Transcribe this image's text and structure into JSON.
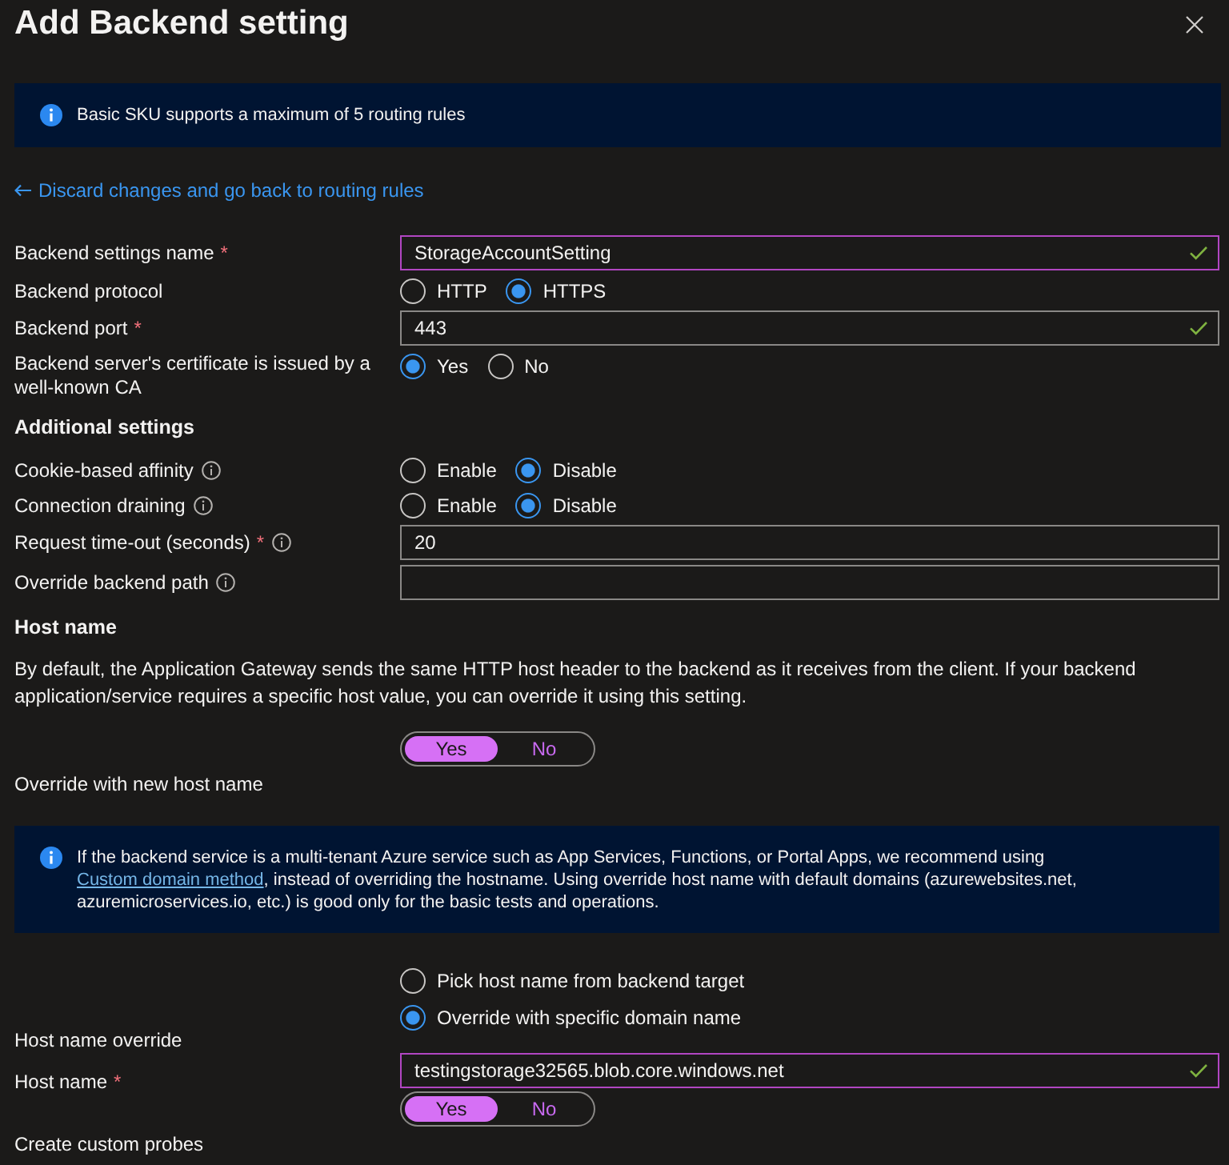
{
  "title": "Add Backend setting",
  "notice": {
    "text": "Basic SKU supports a maximum of 5 routing rules"
  },
  "back_link": {
    "text": "Discard changes and go back to routing rules"
  },
  "rows": [
    {
      "kind": "text",
      "label": "Backend settings name",
      "required_mark": "*",
      "info": false,
      "value": "StorageAccountSetting",
      "modified": true,
      "valid": true
    },
    {
      "kind": "radio",
      "label": "Backend protocol",
      "info": false,
      "options": [
        {
          "label": "HTTP",
          "selected": false
        },
        {
          "label": "HTTPS",
          "selected": true
        }
      ]
    },
    {
      "kind": "text",
      "label": "Backend port",
      "required_mark": "*",
      "info": false,
      "value": "443",
      "modified": false,
      "valid": true
    },
    {
      "kind": "radio",
      "label": "Backend server's certificate is issued by a well-known CA",
      "info": false,
      "options": [
        {
          "label": "Yes",
          "selected": true
        },
        {
          "label": "No",
          "selected": false
        }
      ]
    },
    {
      "kind": "heading",
      "text": "Additional settings"
    },
    {
      "kind": "radio",
      "label": "Cookie-based affinity",
      "info": true,
      "options": [
        {
          "label": "Enable",
          "selected": false
        },
        {
          "label": "Disable",
          "selected": true
        }
      ]
    },
    {
      "kind": "radio",
      "label": "Connection draining",
      "info": true,
      "options": [
        {
          "label": "Enable",
          "selected": false
        },
        {
          "label": "Disable",
          "selected": true
        }
      ]
    },
    {
      "kind": "text",
      "label": "Request time-out (seconds)",
      "required_mark": "*",
      "info": true,
      "value": "20",
      "modified": false,
      "valid": false
    },
    {
      "kind": "text",
      "label": "Override backend path",
      "info": true,
      "modified": false,
      "valid": false
    },
    {
      "kind": "heading",
      "text": "Host name"
    },
    {
      "kind": "paragraph",
      "text": "By default, the Application Gateway sends the same HTTP host header to the backend as it receives from the client. If your backend application/service requires a specific host value, you can override it using this setting."
    },
    {
      "kind": "toggle",
      "label": "Override with new host name",
      "options": [
        {
          "label": "Yes",
          "selected": true
        },
        {
          "label": "No",
          "selected": false
        }
      ]
    },
    {
      "kind": "notice",
      "text_before": "If the backend service is a multi-tenant Azure service such as App Services, Functions, or Portal Apps, we recommend using ",
      "link": "Custom domain method",
      "text_after": ", instead of overriding the hostname. Using override host name with default domains (azurewebsites.net, azuremicroservices.io, etc.) is good only for the basic tests and operations."
    },
    {
      "kind": "radio_stack",
      "label": "Host name override",
      "options": [
        {
          "label": "Pick host name from backend target",
          "selected": false
        },
        {
          "label": "Override with specific domain name",
          "selected": true
        }
      ]
    },
    {
      "kind": "text",
      "label": "Host name",
      "required_mark": "*",
      "info": false,
      "value": "testingstorage32565.blob.core.windows.net",
      "modified": true,
      "valid": true
    },
    {
      "kind": "toggle",
      "label": "Create custom probes",
      "options": [
        {
          "label": "Yes",
          "selected": true
        },
        {
          "label": "No",
          "selected": false
        }
      ]
    }
  ]
}
